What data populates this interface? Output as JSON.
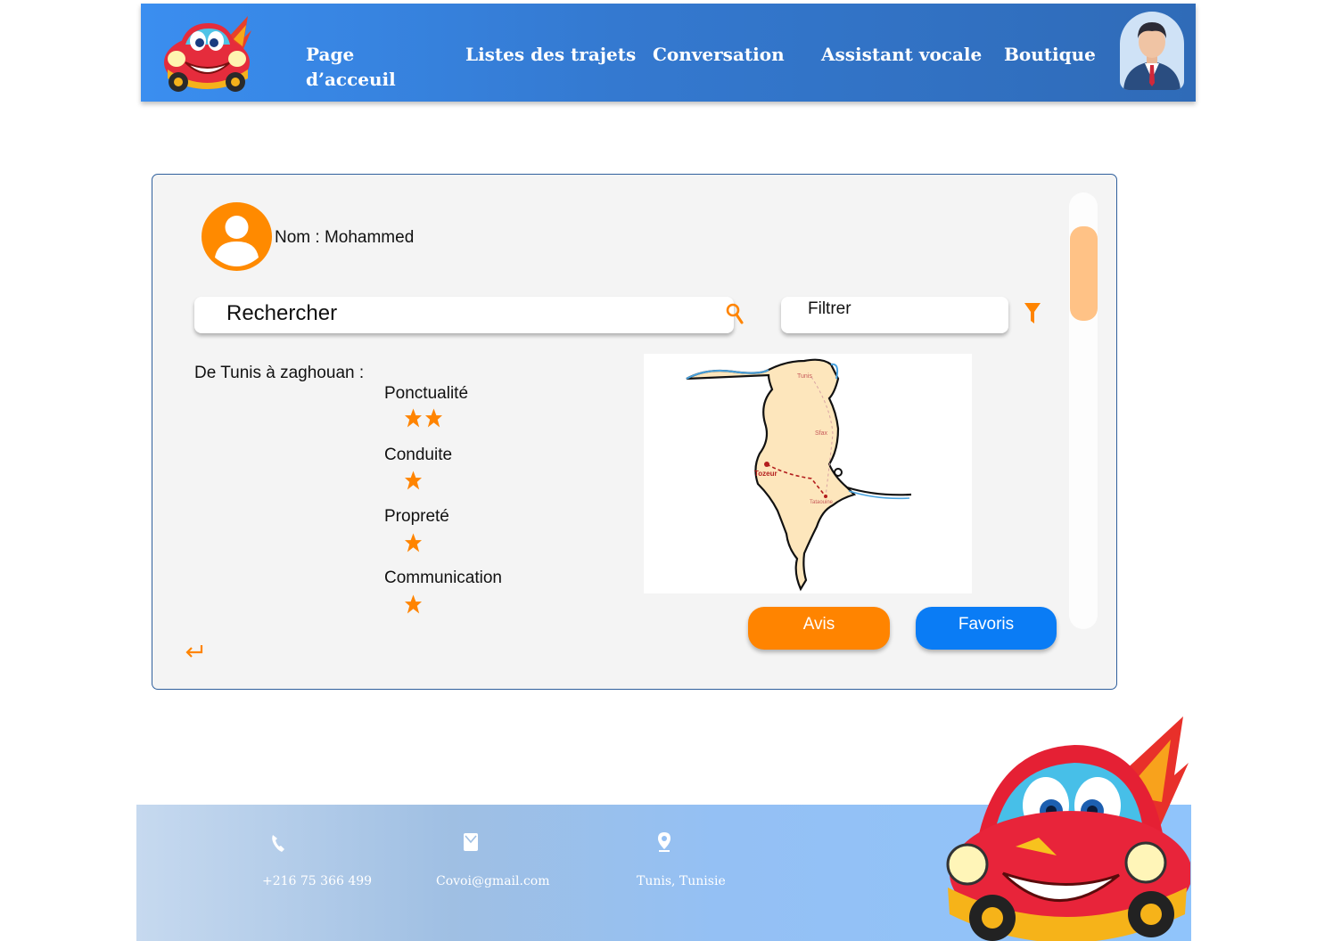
{
  "header": {
    "nav": [
      {
        "label_line1": "Page",
        "label_line2": "d’acceuil"
      },
      {
        "label": "Listes des trajets"
      },
      {
        "label": "Conversation"
      },
      {
        "label": "Assistant vocale"
      },
      {
        "label": "Boutique"
      }
    ],
    "logo_icon": "cartoon-car-logo",
    "avatar_icon": "businessman-avatar"
  },
  "profile": {
    "name_text": "Nom : Mohammed",
    "icon": "user-circle-icon"
  },
  "search": {
    "value": "Rechercher",
    "icon": "search-icon"
  },
  "filter": {
    "value": "Filtrer",
    "icon": "funnel-icon"
  },
  "trip": {
    "route_text": "De Tunis à zaghouan :",
    "criteria": [
      {
        "label": "Ponctualité",
        "stars": 2
      },
      {
        "label": "Conduite",
        "stars": 1
      },
      {
        "label": "Propreté",
        "stars": 1
      },
      {
        "label": "Communication",
        "stars": 1
      }
    ]
  },
  "map": {
    "labels": {
      "tunis": "Tunis",
      "sfax": "Sfax",
      "tozeur": "Tozeur",
      "tataouine": "Tataouine"
    }
  },
  "actions": {
    "avis_label": "Avis",
    "favoris_label": "Favoris"
  },
  "footer": {
    "phone": "+216 75 366 499",
    "email": "Covoi@gmail.com",
    "location": "Tunis, Tunisie"
  },
  "colors": {
    "accent_orange": "#ff8400",
    "accent_blue": "#0a7cf5",
    "header_blue": "#3479d0"
  }
}
